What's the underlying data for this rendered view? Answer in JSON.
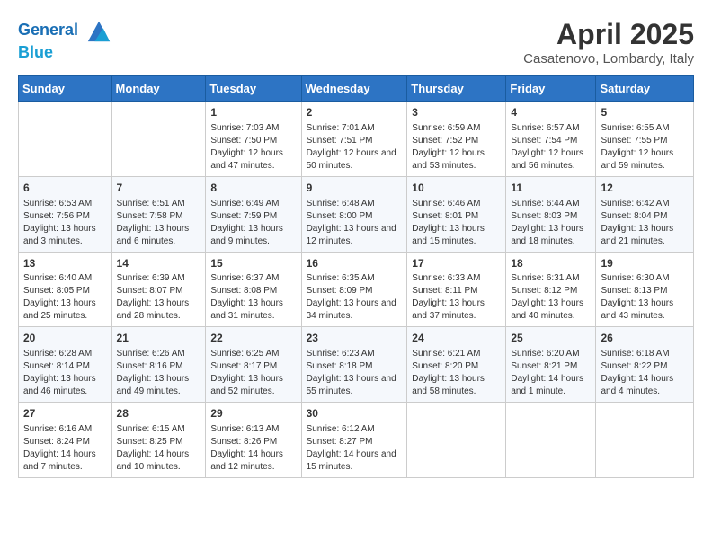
{
  "header": {
    "logo_line1": "General",
    "logo_line2": "Blue",
    "month": "April 2025",
    "location": "Casatenovo, Lombardy, Italy"
  },
  "weekdays": [
    "Sunday",
    "Monday",
    "Tuesday",
    "Wednesday",
    "Thursday",
    "Friday",
    "Saturday"
  ],
  "weeks": [
    [
      {
        "day": "",
        "info": ""
      },
      {
        "day": "",
        "info": ""
      },
      {
        "day": "1",
        "info": "Sunrise: 7:03 AM\nSunset: 7:50 PM\nDaylight: 12 hours and 47 minutes."
      },
      {
        "day": "2",
        "info": "Sunrise: 7:01 AM\nSunset: 7:51 PM\nDaylight: 12 hours and 50 minutes."
      },
      {
        "day": "3",
        "info": "Sunrise: 6:59 AM\nSunset: 7:52 PM\nDaylight: 12 hours and 53 minutes."
      },
      {
        "day": "4",
        "info": "Sunrise: 6:57 AM\nSunset: 7:54 PM\nDaylight: 12 hours and 56 minutes."
      },
      {
        "day": "5",
        "info": "Sunrise: 6:55 AM\nSunset: 7:55 PM\nDaylight: 12 hours and 59 minutes."
      }
    ],
    [
      {
        "day": "6",
        "info": "Sunrise: 6:53 AM\nSunset: 7:56 PM\nDaylight: 13 hours and 3 minutes."
      },
      {
        "day": "7",
        "info": "Sunrise: 6:51 AM\nSunset: 7:58 PM\nDaylight: 13 hours and 6 minutes."
      },
      {
        "day": "8",
        "info": "Sunrise: 6:49 AM\nSunset: 7:59 PM\nDaylight: 13 hours and 9 minutes."
      },
      {
        "day": "9",
        "info": "Sunrise: 6:48 AM\nSunset: 8:00 PM\nDaylight: 13 hours and 12 minutes."
      },
      {
        "day": "10",
        "info": "Sunrise: 6:46 AM\nSunset: 8:01 PM\nDaylight: 13 hours and 15 minutes."
      },
      {
        "day": "11",
        "info": "Sunrise: 6:44 AM\nSunset: 8:03 PM\nDaylight: 13 hours and 18 minutes."
      },
      {
        "day": "12",
        "info": "Sunrise: 6:42 AM\nSunset: 8:04 PM\nDaylight: 13 hours and 21 minutes."
      }
    ],
    [
      {
        "day": "13",
        "info": "Sunrise: 6:40 AM\nSunset: 8:05 PM\nDaylight: 13 hours and 25 minutes."
      },
      {
        "day": "14",
        "info": "Sunrise: 6:39 AM\nSunset: 8:07 PM\nDaylight: 13 hours and 28 minutes."
      },
      {
        "day": "15",
        "info": "Sunrise: 6:37 AM\nSunset: 8:08 PM\nDaylight: 13 hours and 31 minutes."
      },
      {
        "day": "16",
        "info": "Sunrise: 6:35 AM\nSunset: 8:09 PM\nDaylight: 13 hours and 34 minutes."
      },
      {
        "day": "17",
        "info": "Sunrise: 6:33 AM\nSunset: 8:11 PM\nDaylight: 13 hours and 37 minutes."
      },
      {
        "day": "18",
        "info": "Sunrise: 6:31 AM\nSunset: 8:12 PM\nDaylight: 13 hours and 40 minutes."
      },
      {
        "day": "19",
        "info": "Sunrise: 6:30 AM\nSunset: 8:13 PM\nDaylight: 13 hours and 43 minutes."
      }
    ],
    [
      {
        "day": "20",
        "info": "Sunrise: 6:28 AM\nSunset: 8:14 PM\nDaylight: 13 hours and 46 minutes."
      },
      {
        "day": "21",
        "info": "Sunrise: 6:26 AM\nSunset: 8:16 PM\nDaylight: 13 hours and 49 minutes."
      },
      {
        "day": "22",
        "info": "Sunrise: 6:25 AM\nSunset: 8:17 PM\nDaylight: 13 hours and 52 minutes."
      },
      {
        "day": "23",
        "info": "Sunrise: 6:23 AM\nSunset: 8:18 PM\nDaylight: 13 hours and 55 minutes."
      },
      {
        "day": "24",
        "info": "Sunrise: 6:21 AM\nSunset: 8:20 PM\nDaylight: 13 hours and 58 minutes."
      },
      {
        "day": "25",
        "info": "Sunrise: 6:20 AM\nSunset: 8:21 PM\nDaylight: 14 hours and 1 minute."
      },
      {
        "day": "26",
        "info": "Sunrise: 6:18 AM\nSunset: 8:22 PM\nDaylight: 14 hours and 4 minutes."
      }
    ],
    [
      {
        "day": "27",
        "info": "Sunrise: 6:16 AM\nSunset: 8:24 PM\nDaylight: 14 hours and 7 minutes."
      },
      {
        "day": "28",
        "info": "Sunrise: 6:15 AM\nSunset: 8:25 PM\nDaylight: 14 hours and 10 minutes."
      },
      {
        "day": "29",
        "info": "Sunrise: 6:13 AM\nSunset: 8:26 PM\nDaylight: 14 hours and 12 minutes."
      },
      {
        "day": "30",
        "info": "Sunrise: 6:12 AM\nSunset: 8:27 PM\nDaylight: 14 hours and 15 minutes."
      },
      {
        "day": "",
        "info": ""
      },
      {
        "day": "",
        "info": ""
      },
      {
        "day": "",
        "info": ""
      }
    ]
  ]
}
